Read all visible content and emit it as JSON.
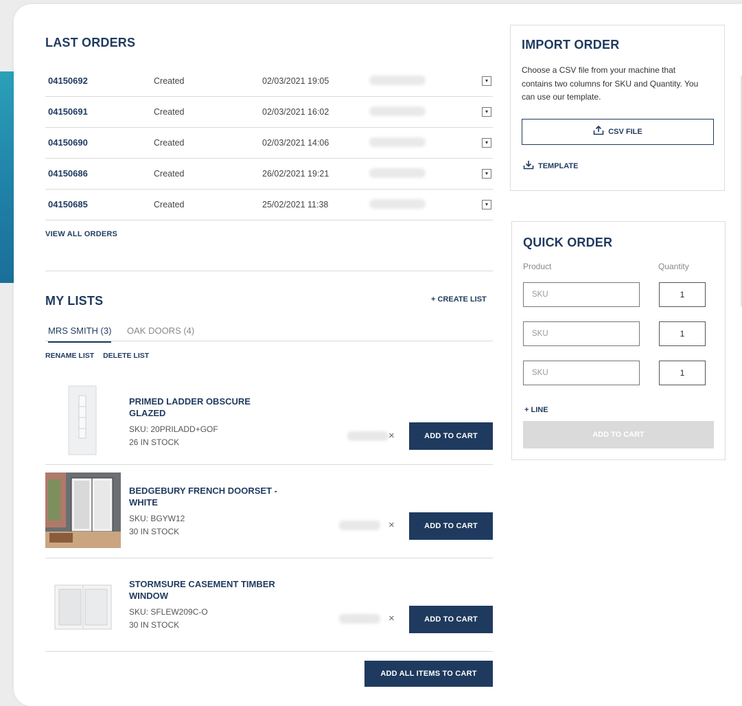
{
  "last_orders": {
    "title": "LAST ORDERS",
    "rows": [
      {
        "number": "04150692",
        "status": "Created",
        "date": "02/03/2021 19:05"
      },
      {
        "number": "04150691",
        "status": "Created",
        "date": "02/03/2021 16:02"
      },
      {
        "number": "04150690",
        "status": "Created",
        "date": "02/03/2021 14:06"
      },
      {
        "number": "04150686",
        "status": "Created",
        "date": "26/02/2021 19:21"
      },
      {
        "number": "04150685",
        "status": "Created",
        "date": "25/02/2021 11:38"
      }
    ],
    "view_all": "VIEW ALL ORDERS"
  },
  "my_lists": {
    "title": "MY LISTS",
    "create_list": "+ CREATE LIST",
    "tabs": [
      {
        "label": "MRS SMITH (3)",
        "active": true
      },
      {
        "label": "OAK DOORS (4)",
        "active": false
      }
    ],
    "rename": "RENAME LIST",
    "delete": "DELETE LIST",
    "items": [
      {
        "title_line1": "PRIMED LADDER OBSCURE",
        "title_line2": "GLAZED",
        "sku": "SKU:  20PRILADD+GOF",
        "stock": "26 IN STOCK",
        "button": "ADD TO CART"
      },
      {
        "title_line1": "BEDGEBURY FRENCH DOORSET -",
        "title_line2": "WHITE",
        "sku": "SKU:  BGYW12",
        "stock": "30 IN STOCK",
        "button": "ADD TO CART"
      },
      {
        "title_line1": "STORMSURE CASEMENT TIMBER",
        "title_line2": "WINDOW",
        "sku": "SKU:  SFLEW209C-O",
        "stock": "30 IN STOCK",
        "button": "ADD TO CART"
      }
    ],
    "add_all": "ADD ALL ITEMS TO CART",
    "remove_symbol": "×"
  },
  "import_order": {
    "title": "IMPORT ORDER",
    "description": "Choose a CSV file from your machine that contains two columns for SKU and Quantity. You can use our template.",
    "csv_button": "CSV FILE",
    "template_link": "TEMPLATE"
  },
  "quick_order": {
    "title": "QUICK ORDER",
    "product_label": "Product",
    "quantity_label": "Quantity",
    "lines": [
      {
        "sku_placeholder": "SKU",
        "qty": "1"
      },
      {
        "sku_placeholder": "SKU",
        "qty": "1"
      },
      {
        "sku_placeholder": "SKU",
        "qty": "1"
      }
    ],
    "add_line": "+ LINE",
    "add_to_cart": "ADD TO CART"
  },
  "colors": {
    "navy": "#1f3a5f",
    "teal": "#2aa0b8",
    "disabled": "#dadada"
  }
}
